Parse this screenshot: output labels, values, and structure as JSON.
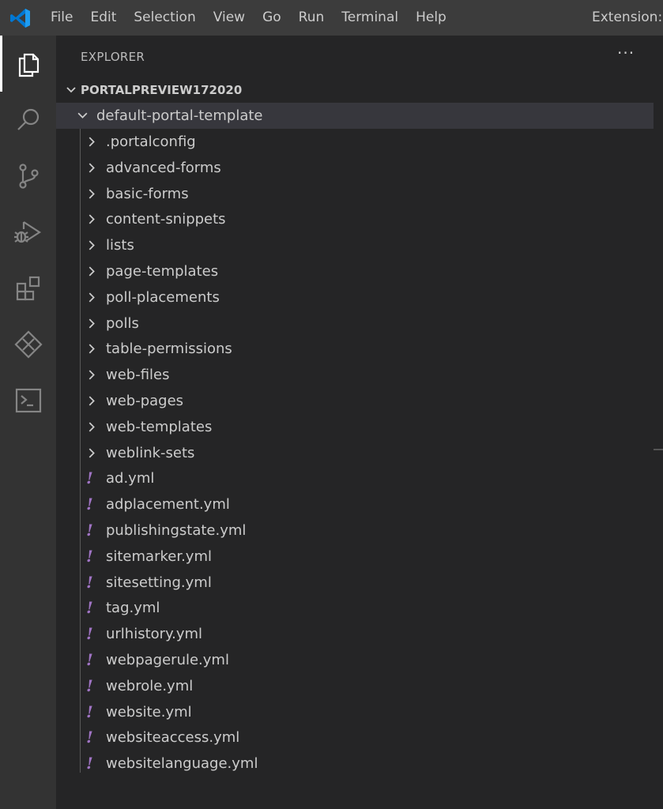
{
  "menu": [
    "File",
    "Edit",
    "Selection",
    "View",
    "Go",
    "Run",
    "Terminal",
    "Help"
  ],
  "window_title": "Extension: P",
  "activity_bar": {
    "items": [
      "explorer-icon",
      "search-icon",
      "source-control-icon",
      "run-debug-icon",
      "extensions-icon",
      "power-platform-icon",
      "terminal-icon"
    ],
    "active": "explorer-icon"
  },
  "explorer": {
    "header": "EXPLORER",
    "more_actions": "···",
    "root": "PORTALPREVIEW172020",
    "folder": "default-portal-template",
    "subfolders": [
      ".portalconfig",
      "advanced-forms",
      "basic-forms",
      "content-snippets",
      "lists",
      "page-templates",
      "poll-placements",
      "polls",
      "table-permissions",
      "web-files",
      "web-pages",
      "web-templates",
      "weblink-sets"
    ],
    "files": [
      "ad.yml",
      "adplacement.yml",
      "publishingstate.yml",
      "sitemarker.yml",
      "sitesetting.yml",
      "tag.yml",
      "urlhistory.yml",
      "webpagerule.yml",
      "webrole.yml",
      "website.yml",
      "websiteaccess.yml",
      "websitelanguage.yml"
    ],
    "file_icon": "!"
  },
  "colors": {
    "accent": "#0078d4",
    "yml_icon": "#a074c4",
    "selection": "#37373d"
  }
}
